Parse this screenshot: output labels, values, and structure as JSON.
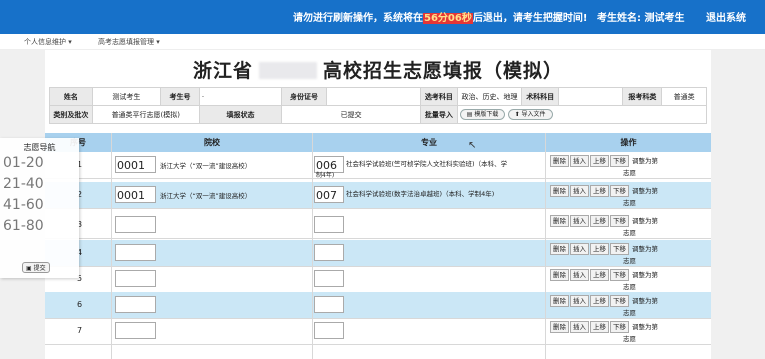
{
  "topbar": {
    "warning_prefix": "请勿进行刷新操作，系统将在",
    "timer": "56分06秒",
    "warning_suffix": "后退出，请考生把握时间!",
    "examinee": "考生姓名: 测试考生",
    "logout": "退出系统"
  },
  "menu": {
    "item1": "个人信息维护 ▾",
    "item2": "高考志愿填报管理 ▾"
  },
  "page_title_left": "浙江省",
  "page_title_right": "高校招生志愿填报（模拟）",
  "info": {
    "name_label": "姓名",
    "name_value": "测试考生",
    "exam_no_label": "考生号",
    "exam_no_value": "·",
    "id_label": "身份证号",
    "id_value": "",
    "subjects_label": "选考科目",
    "subjects_value": "政治、历史、地理",
    "tech_label": "术科科目",
    "tech_value": "",
    "category_label": "报考科类",
    "category_value": "普通类",
    "batch_label": "类别及批次",
    "batch_value": "普通类平行志愿(模拟)",
    "status_label": "填报状态",
    "status_value": "已提交",
    "import_label": "批量导入",
    "template_btn": "模版下载",
    "import_btn": "导入文件"
  },
  "table_headers": {
    "seq": "序号",
    "college": "院校",
    "major": "专业",
    "ops": "操作"
  },
  "ops_labels": {
    "delete": "删除",
    "insert": "插入",
    "up": "上移",
    "down": "下移",
    "adjust": "调整为第",
    "suffix": "志愿"
  },
  "rows": [
    {
      "num": "1",
      "college_code": "0001",
      "college_name": "浙江大学（“双一流”建设高校）",
      "major_code": "006",
      "major_name": "社会科学试验班(竺可桢学院人文社科实验班)（本科、学",
      "major_name_2": "制4年)"
    },
    {
      "num": "2",
      "college_code": "0001",
      "college_name": "浙江大学（“双一流”建设高校）",
      "major_code": "007",
      "major_name": "社会科学试验班(数字法治卓越班)（本科、学制4年)",
      "major_name_2": ""
    },
    {
      "num": "3",
      "college_code": "",
      "college_name": "",
      "major_code": "",
      "major_name": "",
      "major_name_2": ""
    },
    {
      "num": "4",
      "college_code": "",
      "college_name": "",
      "major_code": "",
      "major_name": "",
      "major_name_2": ""
    },
    {
      "num": "5",
      "college_code": "",
      "college_name": "",
      "major_code": "",
      "major_name": "",
      "major_name_2": ""
    },
    {
      "num": "6",
      "college_code": "",
      "college_name": "",
      "major_code": "",
      "major_name": "",
      "major_name_2": ""
    },
    {
      "num": "7",
      "college_code": "",
      "college_name": "",
      "major_code": "",
      "major_name": "",
      "major_name_2": ""
    }
  ],
  "sidenav": {
    "title": "志愿导航",
    "ranges": [
      "01-20",
      "21-40",
      "41-60",
      "61-80"
    ],
    "submit": "提交"
  },
  "colors": {
    "topbar": "#1771c9",
    "header": "#a8d1ee",
    "highlight_row": "#cbe7f6",
    "timer_bg": "#e53636"
  }
}
